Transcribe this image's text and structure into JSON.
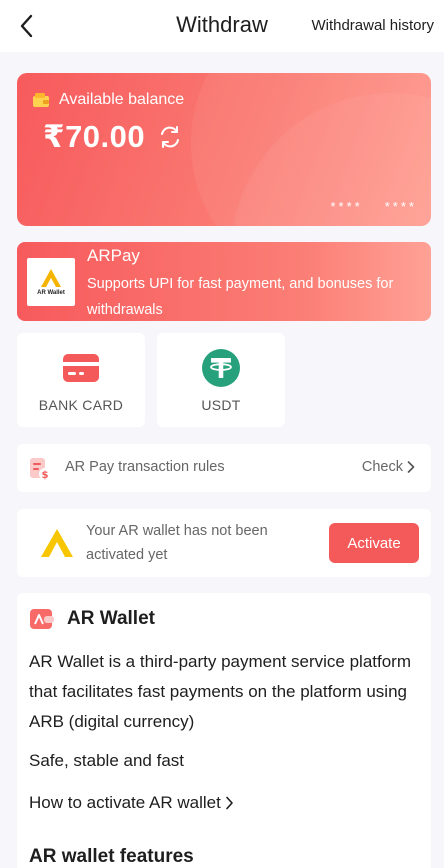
{
  "header": {
    "title": "Withdraw",
    "history_link": "Withdrawal history",
    "back_icon": "chevron-left-icon"
  },
  "balance": {
    "label": "Available balance",
    "amount": "₹70.00",
    "mask_left": "****",
    "mask_right": "****",
    "card_colors": [
      "#f75a5c",
      "#ff9a8e"
    ]
  },
  "arpay": {
    "title": "ARPay",
    "description": "Supports UPI for fast payment, and bonuses for withdrawals",
    "logo_text": "AR Wallet"
  },
  "methods": [
    {
      "label": "BANK CARD",
      "icon": "bank-card-icon",
      "color": "#f55a5b"
    },
    {
      "label": "USDT",
      "icon": "tether-icon",
      "color": "#26a17b"
    }
  ],
  "rules": {
    "label": "AR Pay transaction rules",
    "action": "Check"
  },
  "activate": {
    "message": "Your AR wallet has not been activated yet",
    "button": "Activate",
    "accent": "#f55a5b"
  },
  "ar_wallet": {
    "title": "AR Wallet",
    "description": "AR Wallet is a third-party payment service platform that facilitates fast payments on the platform using ARB (digital currency)",
    "tagline": "Safe, stable and fast",
    "howto": "How to activate AR wallet",
    "features_heading": "AR wallet features"
  }
}
